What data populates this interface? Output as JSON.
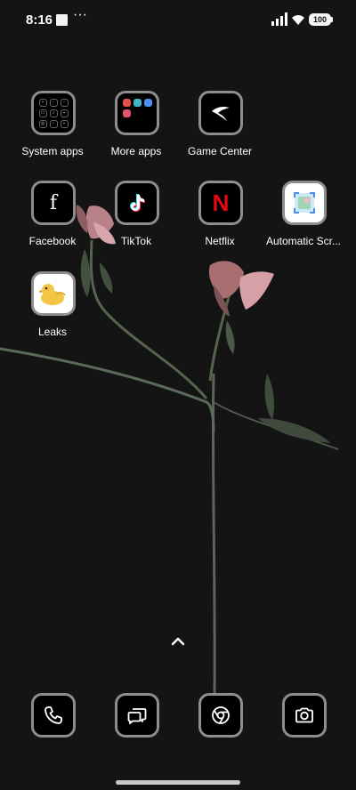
{
  "status_bar": {
    "time": "8:16",
    "overflow_indicator": "···",
    "battery_level": "100"
  },
  "apps": [
    {
      "id": "system-apps",
      "label": "System apps",
      "icon": "folder-icon"
    },
    {
      "id": "more-apps",
      "label": "More apps",
      "icon": "folder-icon"
    },
    {
      "id": "game-center",
      "label": "Game Center",
      "icon": "game-center-icon"
    },
    {
      "id": "facebook",
      "label": "Facebook",
      "icon": "facebook-icon"
    },
    {
      "id": "tiktok",
      "label": "TikTok",
      "icon": "tiktok-icon"
    },
    {
      "id": "netflix",
      "label": "Netflix",
      "icon": "netflix-icon"
    },
    {
      "id": "automatic-scr",
      "label": "Automatic Scr...",
      "icon": "screenshot-app-icon"
    },
    {
      "id": "leaks",
      "label": "Leaks",
      "icon": "duck-icon"
    }
  ],
  "dock": [
    {
      "id": "phone",
      "icon": "phone-icon"
    },
    {
      "id": "messages",
      "icon": "messages-icon"
    },
    {
      "id": "chrome",
      "icon": "chrome-icon"
    },
    {
      "id": "camera",
      "icon": "camera-icon"
    }
  ],
  "colors": {
    "background": "#141414",
    "icon_border": "#8d8d8d",
    "netflix_red": "#e50914",
    "petal_pink": "#c98a92",
    "stem_green": "#4f5e4f"
  }
}
